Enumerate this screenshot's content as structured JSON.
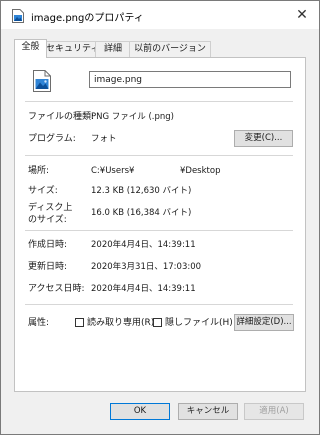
{
  "window": {
    "title": "image.pngのプロパティ",
    "close_glyph": "✕"
  },
  "tabs": [
    {
      "label": "全般",
      "active": true
    },
    {
      "label": "セキュリティ",
      "active": false
    },
    {
      "label": "詳細",
      "active": false
    },
    {
      "label": "以前のバージョン",
      "active": false
    }
  ],
  "general": {
    "file_name": "image.png",
    "file_type": {
      "label": "ファイルの種類:",
      "value": "PNG ファイル (.png)"
    },
    "program": {
      "label": "プログラム:",
      "value": "フォト",
      "button": "変更(C)..."
    },
    "location": {
      "label": "場所:",
      "value_prefix": "C:¥Users¥",
      "value_suffix": "¥Desktop"
    },
    "size": {
      "label": "サイズ:",
      "value": "12.3 KB (12,630 バイト)"
    },
    "size_on_disk": {
      "label_line1": "ディスク上",
      "label_line2": "のサイズ:",
      "value": "16.0 KB (16,384 バイト)"
    },
    "created": {
      "label": "作成日時:",
      "value": "2020年4月4日、14:39:11"
    },
    "modified": {
      "label": "更新日時:",
      "value": "2020年3月31日、17:03:00"
    },
    "accessed": {
      "label": "アクセス日時:",
      "value": "2020年4月4日、14:39:11"
    },
    "attributes": {
      "label": "属性:",
      "readonly": {
        "label": "読み取り専用(R)",
        "checked": false
      },
      "hidden": {
        "label": "隠しファイル(H)",
        "checked": false
      },
      "advanced_button": "詳細設定(D)..."
    }
  },
  "footer": {
    "ok": "OK",
    "cancel": "キャンセル",
    "apply": "適用(A)"
  },
  "colors": {
    "accent": "#0078d7",
    "window_bg": "#f0f0f0",
    "panel_bg": "#ffffff"
  },
  "icons": {
    "app": "image-file-icon",
    "file": "image-file-icon",
    "close": "close-icon"
  }
}
